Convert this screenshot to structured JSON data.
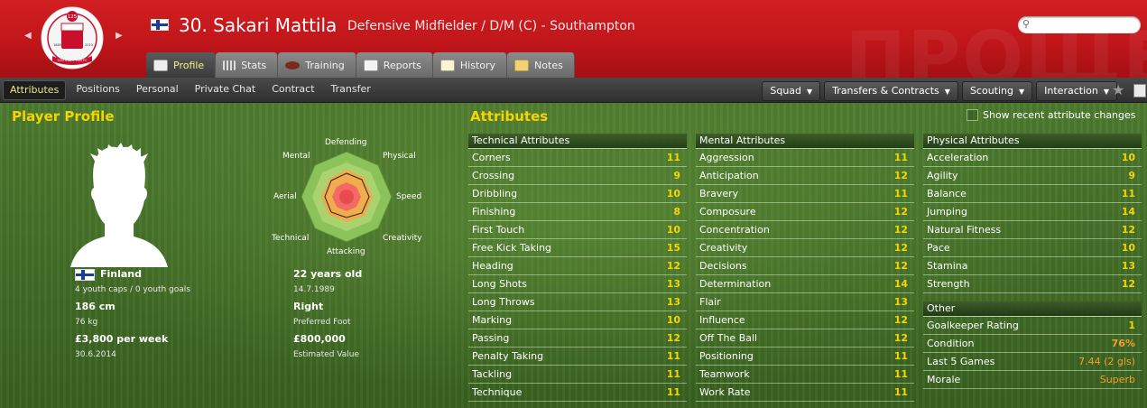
{
  "header": {
    "title": "30. Sakari Mattila",
    "subtitle": "Defensive Midfielder / D/M (C) - Southampton",
    "background_word": "ПРОЩЕ",
    "crest": {
      "number": "125",
      "year_left": "1885",
      "year_right": "2010",
      "name": "SOUTHAMPTON FC"
    },
    "search_placeholder": ""
  },
  "tabs": [
    {
      "label": "Profile",
      "icon": "profile-icon",
      "active": true
    },
    {
      "label": "Stats",
      "icon": "stats-icon"
    },
    {
      "label": "Training",
      "icon": "training-icon"
    },
    {
      "label": "Reports",
      "icon": "reports-icon"
    },
    {
      "label": "History",
      "icon": "history-icon"
    },
    {
      "label": "Notes",
      "icon": "notes-icon"
    }
  ],
  "subnav": {
    "items": [
      "Attributes",
      "Positions",
      "Personal",
      "Private Chat",
      "Contract",
      "Transfer"
    ],
    "active": "Attributes",
    "menus": [
      "Squad",
      "Transfers & Contracts",
      "Scouting",
      "Interaction"
    ]
  },
  "profile": {
    "title": "Player Profile",
    "nationality": "Finland",
    "caps": "4 youth caps / 0 youth goals",
    "height": "186 cm",
    "weight": "76 kg",
    "wage": "£3,800 per week",
    "contract_end": "30.6.2014",
    "age": "22 years old",
    "dob": "14.7.1989",
    "preferred_foot": "Right",
    "preferred_foot_label": "Preferred Foot",
    "value": "£800,000",
    "value_label": "Estimated Value",
    "radar_labels": {
      "defending": "Defending",
      "physical": "Physical",
      "speed": "Speed",
      "creativity": "Creativity",
      "attacking": "Attacking",
      "technical": "Technical",
      "aerial": "Aerial",
      "mental": "Mental"
    }
  },
  "attributes": {
    "title": "Attributes",
    "show_recent_label": "Show recent attribute changes",
    "technical": {
      "header": "Technical Attributes",
      "rows": [
        {
          "name": "Corners",
          "value": "11"
        },
        {
          "name": "Crossing",
          "value": "9"
        },
        {
          "name": "Dribbling",
          "value": "10"
        },
        {
          "name": "Finishing",
          "value": "8"
        },
        {
          "name": "First Touch",
          "value": "10"
        },
        {
          "name": "Free Kick Taking",
          "value": "15"
        },
        {
          "name": "Heading",
          "value": "12"
        },
        {
          "name": "Long Shots",
          "value": "13"
        },
        {
          "name": "Long Throws",
          "value": "13"
        },
        {
          "name": "Marking",
          "value": "10"
        },
        {
          "name": "Passing",
          "value": "12"
        },
        {
          "name": "Penalty Taking",
          "value": "11"
        },
        {
          "name": "Tackling",
          "value": "11"
        },
        {
          "name": "Technique",
          "value": "11"
        }
      ]
    },
    "mental": {
      "header": "Mental Attributes",
      "rows": [
        {
          "name": "Aggression",
          "value": "11"
        },
        {
          "name": "Anticipation",
          "value": "12"
        },
        {
          "name": "Bravery",
          "value": "11"
        },
        {
          "name": "Composure",
          "value": "12"
        },
        {
          "name": "Concentration",
          "value": "12"
        },
        {
          "name": "Creativity",
          "value": "12"
        },
        {
          "name": "Decisions",
          "value": "12"
        },
        {
          "name": "Determination",
          "value": "14"
        },
        {
          "name": "Flair",
          "value": "13"
        },
        {
          "name": "Influence",
          "value": "12"
        },
        {
          "name": "Off The Ball",
          "value": "12"
        },
        {
          "name": "Positioning",
          "value": "11"
        },
        {
          "name": "Teamwork",
          "value": "11"
        },
        {
          "name": "Work Rate",
          "value": "11"
        }
      ]
    },
    "physical": {
      "header": "Physical Attributes",
      "rows": [
        {
          "name": "Acceleration",
          "value": "10"
        },
        {
          "name": "Agility",
          "value": "9"
        },
        {
          "name": "Balance",
          "value": "11"
        },
        {
          "name": "Jumping",
          "value": "14"
        },
        {
          "name": "Natural Fitness",
          "value": "12"
        },
        {
          "name": "Pace",
          "value": "10"
        },
        {
          "name": "Stamina",
          "value": "13"
        },
        {
          "name": "Strength",
          "value": "12"
        }
      ]
    },
    "other": {
      "header": "Other",
      "rows": [
        {
          "name": "Goalkeeper Rating",
          "value": "1"
        },
        {
          "name": "Condition",
          "value": "76%"
        },
        {
          "name": "Last 5 Games",
          "value": "7.44 (2 gls)"
        },
        {
          "name": "Morale",
          "value": "Superb"
        }
      ]
    }
  },
  "colors": {
    "header_red": "#c0161a",
    "value_yellow": "#f5d400",
    "value_orange": "#f3a02e",
    "title_yellow": "#f5d400"
  }
}
